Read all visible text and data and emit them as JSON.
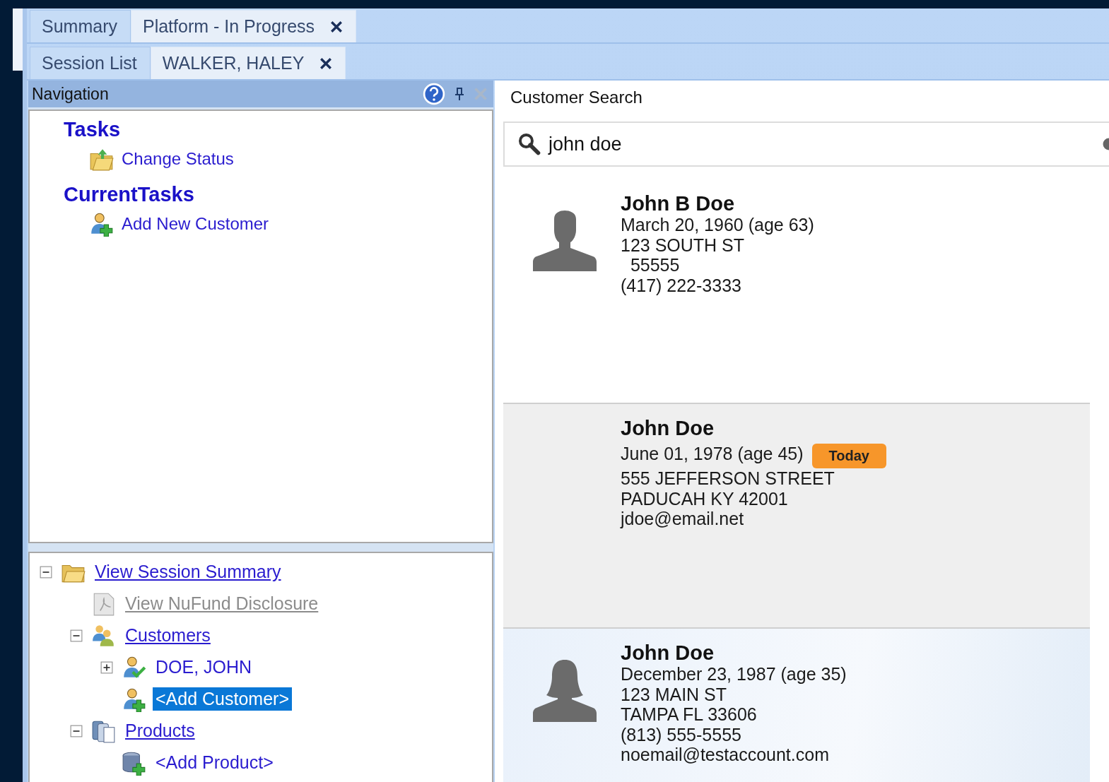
{
  "document_tabs": [
    {
      "label": "Summary",
      "selected": false
    },
    {
      "label": "Platform - In Progress",
      "selected": true
    }
  ],
  "session_tabs": [
    {
      "label": "Session List",
      "selected": false
    },
    {
      "label": "WALKER, HALEY",
      "selected": true
    }
  ],
  "navigation": {
    "title": "Navigation",
    "task_groups": [
      {
        "title": "Tasks",
        "items": [
          {
            "label": "Change Status",
            "kind": "status"
          }
        ]
      },
      {
        "title": "CurrentTasks",
        "items": [
          {
            "label": "Add New Customer",
            "kind": "add-person"
          }
        ]
      }
    ],
    "tree": [
      {
        "label": "View Session Summary",
        "kind": "folder",
        "link": true,
        "disabled": false,
        "selected": false,
        "expanded": true,
        "children": [
          {
            "label": "View NuFund Disclosure",
            "kind": "document",
            "link": true,
            "disabled": true,
            "selected": false
          },
          {
            "label": "Customers",
            "kind": "people",
            "link": true,
            "disabled": false,
            "selected": false,
            "expanded": true,
            "children": [
              {
                "label": "DOE, JOHN",
                "kind": "person-check",
                "link": false,
                "disabled": false,
                "selected": false,
                "expanded": false
              },
              {
                "label": "<Add Customer>",
                "kind": "add-person",
                "link": false,
                "disabled": false,
                "selected": true
              }
            ]
          },
          {
            "label": "Products",
            "kind": "products",
            "link": true,
            "disabled": false,
            "selected": false,
            "expanded": true,
            "children": [
              {
                "label": "<Add Product>",
                "kind": "add-product",
                "link": false,
                "disabled": false,
                "selected": false
              }
            ]
          }
        ]
      }
    ]
  },
  "customer_search": {
    "title": "Customer Search",
    "search": {
      "value": "john doe"
    },
    "results": [
      {
        "name": "John B Doe",
        "birth": "March 20, 1960 (age 63)",
        "kind": "male",
        "selected": false,
        "lines": [
          "123 SOUTH ST",
          "  55555",
          "(417) 222-3333"
        ]
      },
      {
        "name": "John Doe",
        "birth": "June 01, 1978 (age 45)",
        "badge": "Today",
        "kind": "blank",
        "selected": true,
        "lines": [
          "555 JEFFERSON STREET",
          "PADUCAH KY 42001",
          "jdoe@email.net"
        ]
      },
      {
        "name": "John Doe",
        "birth": "December 23, 1987 (age 35)",
        "kind": "female",
        "selected": false,
        "lines": [
          "123 MAIN ST",
          "TAMPA FL 33606",
          "(813) 555-5555",
          "noemail@testaccount.com"
        ]
      }
    ]
  }
}
